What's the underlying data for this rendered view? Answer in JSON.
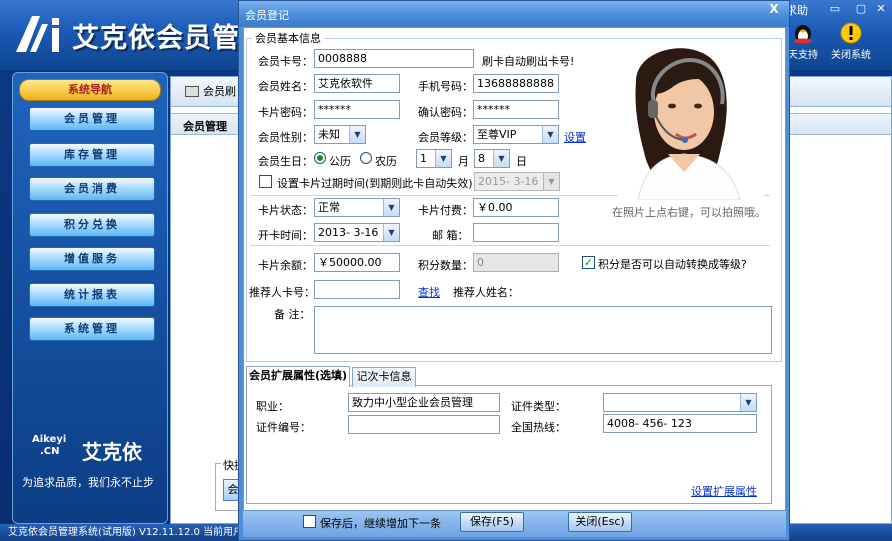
{
  "app": {
    "title": "艾克依会员管理",
    "help": "求助",
    "toolbar": {
      "support": "天支持",
      "close_system": "关闭系统"
    },
    "nav_header": "系统导航",
    "nav_items": [
      "会员管理",
      "库存管理",
      "会员消费",
      "积分兑换",
      "增值服务",
      "统计报表",
      "系统管理"
    ],
    "brand_en_1": "Aikeyi",
    "brand_en_2": ".CN",
    "brand_cn": "艾克依",
    "slogan": "为追求品质，我们永不止步",
    "main_tab": "会员刷",
    "main_sub": "会员管理",
    "quick_label": "快捷",
    "quick_btn": "会",
    "status": "艾克依会员管理系统(试用版)   V12.11.12.0  当前用户：建立日期表   http://www.aikeyi.cn"
  },
  "dialog": {
    "title": "会员登记",
    "group_title": "会员基本信息",
    "labels": {
      "card_no": "会员卡号：",
      "name": "会员姓名：",
      "card_pwd": "卡片密码：",
      "gender": "会员性别：",
      "birthday": "会员生日：",
      "expire": "设置卡片过期时间(到期则此卡自动失效)",
      "status": "卡片状态：",
      "open_time": "开卡时间：",
      "balance": "卡片余额：",
      "referrer_card": "推荐人卡号：",
      "remark": "备  注：",
      "phone": "手机号码：",
      "confirm_pwd": "确认密码：",
      "level": "会员等级：",
      "pay": "卡片付费：",
      "email": "邮  箱：",
      "points": "积分数量：",
      "referrer_name": "推荐人姓名：",
      "month": "月",
      "day": "日"
    },
    "values": {
      "card_no": "0008888",
      "card_hint": "刷卡自动刷出卡号!",
      "name": "艾克依软件",
      "phone": "13688888888",
      "card_pwd": "******",
      "confirm_pwd": "******",
      "gender": "未知",
      "level": "至尊VIP",
      "level_link": "设置",
      "calendar_solar": "公历",
      "calendar_lunar": "农历",
      "birth_month": "1",
      "birth_day": "8",
      "expire_date": "2015- 3-16",
      "status": "正常",
      "pay": "￥0.00",
      "open_time": "2013- 3-16",
      "email": "",
      "balance": "￥50000.00",
      "points": "0",
      "auto_upgrade": "积分是否可以自动转换成等级?",
      "find_link": "查找",
      "referrer_card": "",
      "remark": ""
    },
    "photo_hint": "在照片上点右键，可以拍照哦。",
    "tabs": [
      "会员扩展属性(选填)",
      "记次卡信息"
    ],
    "ext": {
      "job_label": "职业：",
      "job_value": "致力中小型企业会员管理",
      "cert_type_label": "证件类型：",
      "cert_type_value": "",
      "cert_no_label": "证件编号：",
      "cert_no_value": "",
      "hotline_label": "全国热线：",
      "hotline_value": "4008- 456- 123",
      "settings_link": "设置扩展属性"
    },
    "footer": {
      "continue_label": "保存后，继续增加下一条",
      "save": "保存(F5)",
      "close": "关闭(Esc)"
    },
    "close_glyph": "X"
  }
}
